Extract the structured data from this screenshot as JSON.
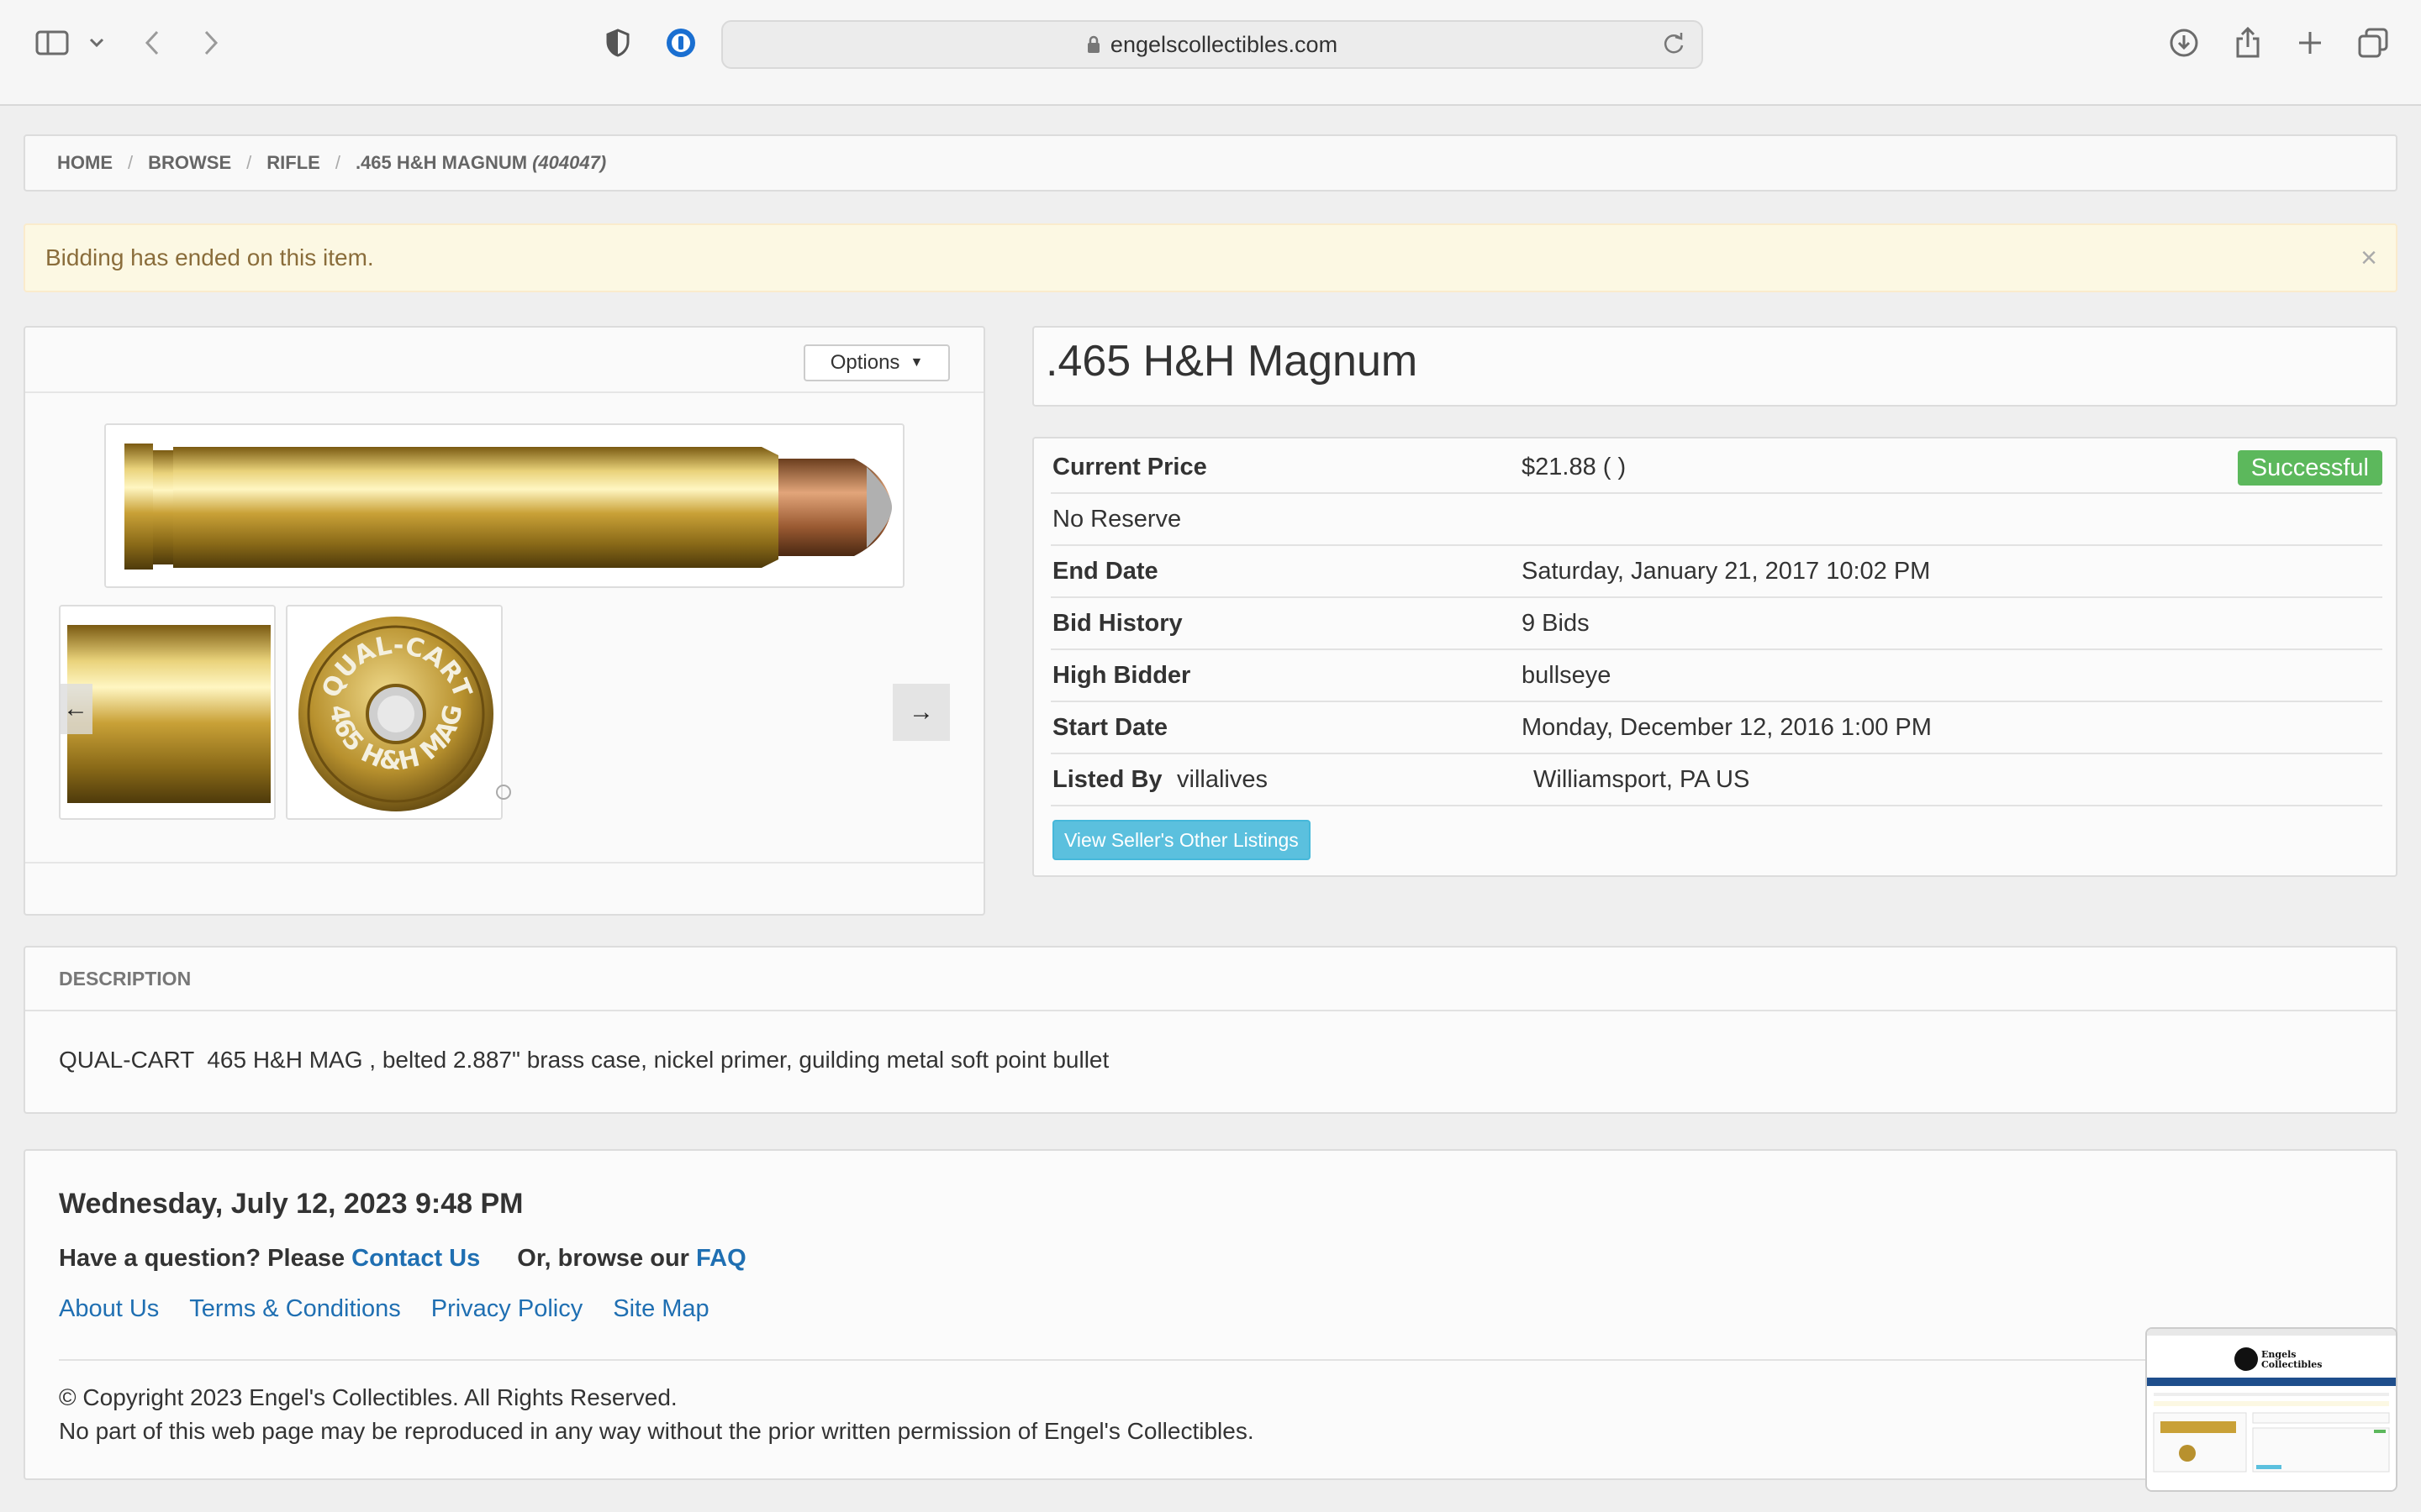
{
  "browser": {
    "url": "engelscollectibles.com"
  },
  "breadcrumb": {
    "home": "HOME",
    "browse": "BROWSE",
    "category": "RIFLE",
    "item": ".465 H&H MAGNUM",
    "item_id": "(404047)",
    "separator": "/"
  },
  "alert": {
    "message": "Bidding has ended on this item.",
    "close": "×"
  },
  "gallery": {
    "options_label": "Options",
    "thumb2_text_top": "QUAL-CART",
    "thumb2_text_bottom": "465 H&H MAG",
    "prev_arrow": "←",
    "next_arrow": "→"
  },
  "item": {
    "title": ".465 H&H Magnum"
  },
  "details": {
    "current_price_label": "Current Price",
    "current_price": "$21.88   ( )",
    "status_badge": "Successful",
    "reserve": "No Reserve",
    "end_date_label": "End Date",
    "end_date": "Saturday, January 21, 2017 10:02 PM",
    "bid_history_label": "Bid History",
    "bid_history": "9 Bids",
    "high_bidder_label": "High Bidder",
    "high_bidder": "bullseye",
    "start_date_label": "Start Date",
    "start_date": "Monday, December 12, 2016 1:00 PM",
    "listed_by_label": "Listed By",
    "listed_by": "villalives",
    "location": "Williamsport, PA US",
    "seller_button": "View Seller's Other Listings"
  },
  "description": {
    "header": "DESCRIPTION",
    "text": "QUAL-CART  465 H&H MAG , belted 2.887\" brass case, nickel primer, guilding metal soft point bullet"
  },
  "footer": {
    "date": "Wednesday, July 12, 2023 9:48 PM",
    "question_prefix": "Have a question? Please ",
    "contact_link": "Contact Us",
    "browse_prefix": "Or, browse our ",
    "faq_link": "FAQ",
    "links": [
      "About Us",
      "Terms & Conditions",
      "Privacy Policy",
      "Site Map"
    ],
    "copyright": "©   Copyright 2023 Engel's Collectibles. All Rights Reserved.",
    "notice": "No part of this web page may be reproduced in any way without the prior written permission of Engel's Collectibles."
  },
  "mini_preview": {
    "logo_line1": "Engels",
    "logo_line2": "Collectibles"
  },
  "colors": {
    "link": "#1f6fb2",
    "success": "#5cb85c",
    "info_button": "#5bc0de",
    "alert_bg": "#fcf8e3",
    "alert_text": "#8a6d3b"
  }
}
